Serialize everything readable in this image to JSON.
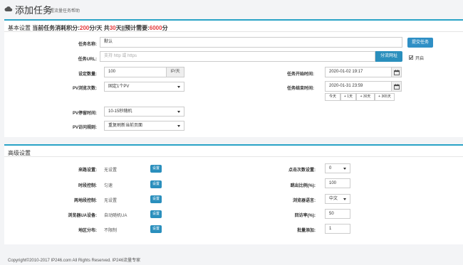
{
  "header": {
    "title": "添加任务",
    "subtitle": "设置流量任务帮助"
  },
  "basic": {
    "heading_prefix": "基本设置",
    "summary_label": "当前任务消耗积分:",
    "points_per_day": "200",
    "unit_per_day": "分/天 共",
    "days": "30",
    "days_suffix": "天||预计需要:",
    "total": "6000",
    "total_suffix": "分",
    "task_name_label": "任务名称:",
    "task_name_value": "默认",
    "submit_button": "提交任务",
    "task_url_label": "任务URL:",
    "task_url_placeholder": "支持 http 或 https",
    "analyze_button": "分流网址",
    "enable_label": "开启",
    "enable_checked": true,
    "daily_count_label": "设定数量:",
    "daily_count_value": "100",
    "daily_count_unit": "IP/天",
    "start_time_label": "任务开始时间:",
    "start_time_value": "2020-01-02 19:17",
    "pv_depth_label": "PV浏览次数:",
    "pv_depth_value": "固定1个PV",
    "end_time_label": "任务结束时间:",
    "end_time_value": "2020-01-31 23:59",
    "quick_ranges": [
      "今天",
      "+ 1天",
      "+ 30天",
      "+ 365天"
    ],
    "pv_stay_label": "PV停留时间:",
    "pv_stay_value": "10-15秒随机",
    "pv_rule_label": "PV访问规则:",
    "pv_rule_value": "重复刷新当前页面"
  },
  "advanced": {
    "heading": "高级设置",
    "source_label": "来路设置:",
    "source_value": "无设置",
    "time_control_label": "时段控制:",
    "time_control_value": "匀速",
    "region_control_label": "两地段控制:",
    "region_control_value": "无设置",
    "ua_label": "浏览器UA设备:",
    "ua_value": "自动随机UA",
    "area_label": "地区分布:",
    "area_value": "不限制",
    "set_button": "设置",
    "click_count_label": "点击次数设置:",
    "click_count_value": "0",
    "jump_ratio_label": "跳出比例(%):",
    "jump_ratio_value": "100",
    "browser_lang_label": "浏览器语言:",
    "browser_lang_value": "中文",
    "return_rate_label": "回访率(%):",
    "return_rate_value": "50",
    "batch_add_label": "批量添加:",
    "batch_add_value": "1"
  },
  "footer": {
    "copyright": "Copyright©2010-2017 IP246.com All Rights Reserved. IP246流量专家"
  },
  "colors": {
    "accent": "#29a3c6",
    "button": "#2a8fbd",
    "highlight_red": "#e4393c"
  }
}
